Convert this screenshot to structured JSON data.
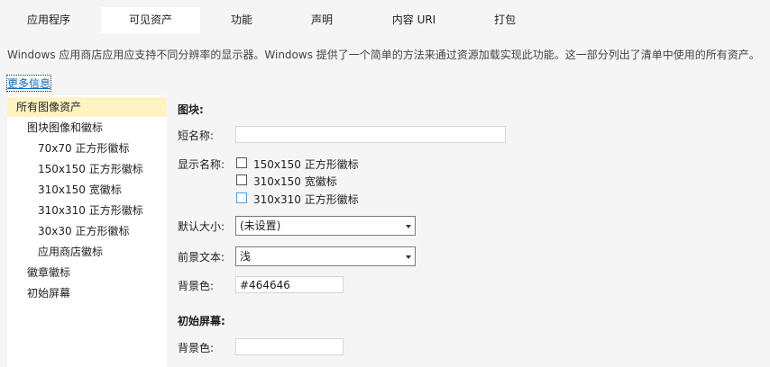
{
  "tabs": [
    {
      "label": "应用程序",
      "active": false
    },
    {
      "label": "可见资产",
      "active": true
    },
    {
      "label": "功能",
      "active": false
    },
    {
      "label": "声明",
      "active": false
    },
    {
      "label": "内容 URI",
      "active": false
    },
    {
      "label": "打包",
      "active": false
    }
  ],
  "description": "Windows 应用商店应用应支持不同分辨率的显示器。Windows 提供了一个简单的方法来通过资源加载实现此功能。这一部分列出了清单中使用的所有资产。",
  "more_info": "更多信息",
  "tree": {
    "items": [
      {
        "label": "所有图像资产",
        "selected": true
      },
      {
        "label": "图块图像和徽标"
      },
      {
        "label": "70x70 正方形徽标"
      },
      {
        "label": "150x150 正方形徽标"
      },
      {
        "label": "310x150 宽徽标"
      },
      {
        "label": "310x310 正方形徽标"
      },
      {
        "label": "30x30 正方形徽标"
      },
      {
        "label": "应用商店徽标"
      },
      {
        "label": "徽章徽标"
      },
      {
        "label": "初始屏幕"
      }
    ]
  },
  "tile": {
    "heading": "图块:",
    "short_name_label": "短名称:",
    "short_name_value": "",
    "display_name_label": "显示名称:",
    "checkboxes": [
      {
        "label": "150x150 正方形徽标",
        "checked": false
      },
      {
        "label": "310x150 宽徽标",
        "checked": false
      },
      {
        "label": "310x310 正方形徽标",
        "checked": false
      }
    ],
    "default_size_label": "默认大小:",
    "default_size_value": "(未设置)",
    "foreground_label": "前景文本:",
    "foreground_value": "浅",
    "background_label": "背景色:",
    "background_value": "#464646"
  },
  "splash": {
    "heading": "初始屏幕:",
    "background_label": "背景色:",
    "background_value": ""
  }
}
